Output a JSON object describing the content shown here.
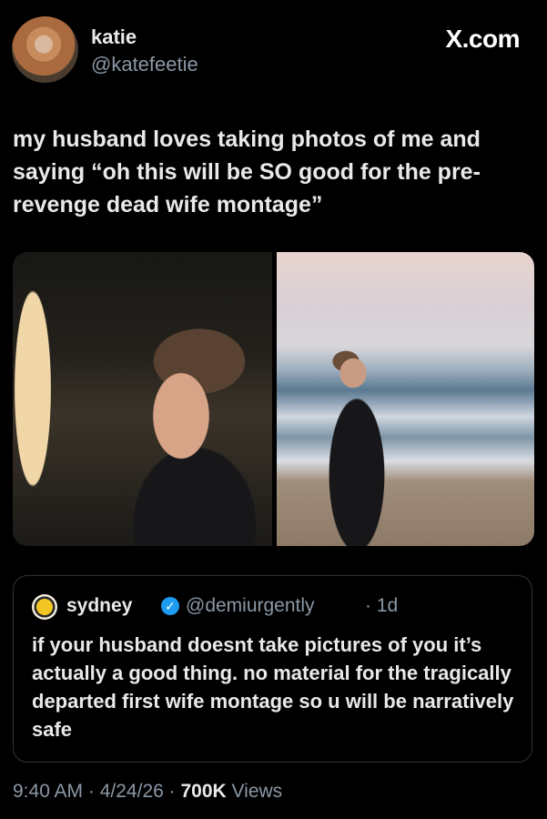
{
  "tweet": {
    "author_name": "katie",
    "author_handle": "@katefeetie",
    "site_label": "X.com",
    "text": "my husband loves taking photos of me and saying “oh this will be SO good for the pre-revenge dead wife montage”",
    "photos": [
      "woman-in-alley-night",
      "woman-on-beach-dusk"
    ]
  },
  "quoted": {
    "name": "sydney",
    "handle": "@demiurgently",
    "time": "· 1d",
    "text": "if your husband doesnt take pictures of you it’s actually a good thing. no material for the tragically departed first wife montage so u will be narratively safe",
    "verified_icon": "verified-badge-icon"
  },
  "meta": {
    "time": "9:40 AM",
    "sep1": " · ",
    "date": "4/24/26",
    "sep2": " · ",
    "views_count": "700K",
    "views_label": " Views"
  },
  "colors": {
    "background": "#000000",
    "text": "#e7e9ea",
    "secondary": "#8b98a5",
    "verified": "#1d9bf0",
    "border": "#2f3336"
  }
}
